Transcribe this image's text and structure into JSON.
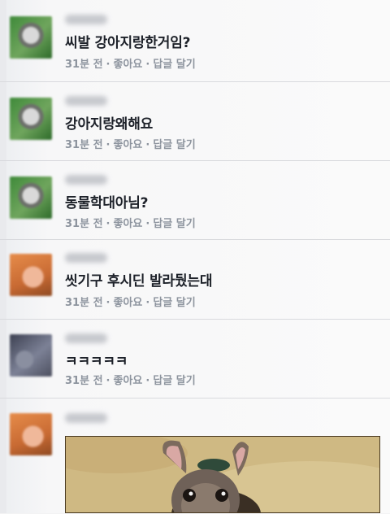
{
  "comments": [
    {
      "text": "씨발 강아지랑한거임?",
      "time": "31분 전",
      "like": "좋아요",
      "reply": "답글 달기",
      "avatar": "green"
    },
    {
      "text": "강아지랑왜해요",
      "time": "31분 전",
      "like": "좋아요",
      "reply": "답글 달기",
      "avatar": "green"
    },
    {
      "text": "동물학대아님?",
      "time": "31분 전",
      "like": "좋아요",
      "reply": "답글 달기",
      "avatar": "green"
    },
    {
      "text": "씻기구 후시딘 발라뒀는대",
      "time": "31분 전",
      "like": "좋아요",
      "reply": "답글 달기",
      "avatar": "orange"
    },
    {
      "text": "ㅋㅋㅋㅋㅋ",
      "time": "31분 전",
      "like": "좋아요",
      "reply": "답글 달기",
      "avatar": "gray"
    }
  ],
  "last_comment": {
    "avatar": "orange",
    "attachment": "dog-photo"
  },
  "colors": {
    "text": "#1d2129",
    "meta": "#8d949e",
    "divider": "#d9dade"
  }
}
